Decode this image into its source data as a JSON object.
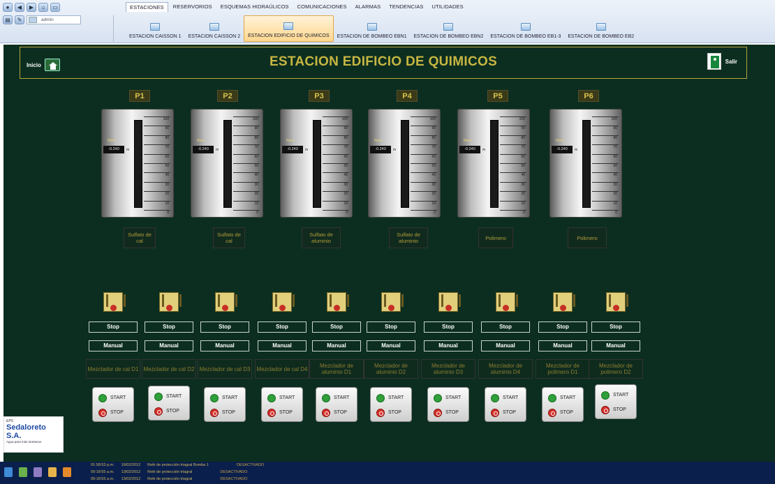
{
  "menu_tabs": [
    "ESTACIONES",
    "RESERVORIOS",
    "ESQUEMAS HIDRAÚLICOS",
    "COMUNICACIONES",
    "ALARMAS",
    "TENDENCIAS",
    "UTILIDADES"
  ],
  "user": "admin",
  "station_tabs": [
    "ESTACION CAISSON 1",
    "ESTACION CAISSON 2",
    "ESTACION EDIFICIO DE QUIMICOS",
    "ESTACION DE BOMBEO EBN1",
    "ESTACION DE BOMBEO EBN2",
    "ESTACION DE BOMBEO EB1-3",
    "ESTACION DE BOMBEO EB2"
  ],
  "active_station": "ESTACION EDIFICIO DE QUIMICOS",
  "header": {
    "home_label": "Inicio",
    "title": "ESTACION EDIFICIO DE QUIMICOS",
    "exit_label": "Salir"
  },
  "tanks": [
    {
      "label": "P1",
      "level_label": "Nivel",
      "level": "-0.240",
      "unit": "m",
      "chemical": "Sulfato de cal"
    },
    {
      "label": "P2",
      "level_label": "Nivel",
      "level": "-0.240",
      "unit": "m",
      "chemical": "Sulfato de cal"
    },
    {
      "label": "P3",
      "level_label": "Nivel",
      "level": "-0.240",
      "unit": "m",
      "chemical": "Sulfato de aluminio"
    },
    {
      "label": "P4",
      "level_label": "Nivel",
      "level": "-0.240",
      "unit": "m",
      "chemical": "Sulfato de aluminio"
    },
    {
      "label": "P5",
      "level_label": "Nivel",
      "level": "-0.240",
      "unit": "m",
      "chemical": "Polimero"
    },
    {
      "label": "P6",
      "level_label": "Nivel",
      "level": "-0.240",
      "unit": "m",
      "chemical": "Polimero"
    }
  ],
  "scale": [
    "100",
    "90",
    "80",
    "70",
    "60",
    "50",
    "40",
    "30",
    "20",
    "10",
    "0"
  ],
  "mixers": [
    {
      "state": "Stop",
      "mode": "Manual",
      "name": "Mezclador de cal D1"
    },
    {
      "state": "Stop",
      "mode": "Manual",
      "name": "Mezclador de cal D2"
    },
    {
      "state": "Stop",
      "mode": "Manual",
      "name": "Mezclador de cal D3"
    },
    {
      "state": "Stop",
      "mode": "Manual",
      "name": "Mezclador de cal D4"
    },
    {
      "state": "Stop",
      "mode": "Manual",
      "name": "Mezclador de aluminio D1"
    },
    {
      "state": "Stop",
      "mode": "Manual",
      "name": "Mezclador de aluminio D2"
    },
    {
      "state": "Stop",
      "mode": "Manual",
      "name": "Mezclador de aluminio D3"
    },
    {
      "state": "Stop",
      "mode": "Manual",
      "name": "Mezclador de aluminio D4"
    },
    {
      "state": "Stop",
      "mode": "Manual",
      "name": "Mezclador de polimero D1"
    },
    {
      "state": "Stop",
      "mode": "Manual",
      "name": "Mezclador de polimero D2"
    }
  ],
  "start_label": "START",
  "stop_label": "STOP",
  "logo": {
    "prefix": "EPS",
    "name": "Sedaloreto S.A.",
    "tagline": "Agua para más loretanos"
  },
  "alarms": [
    {
      "time": "01:58:53 p.m.",
      "date": "16/02/2012",
      "text": "Relé de protección triagral Bomba 1",
      "status": "DESACTIVADO"
    },
    {
      "time": "09:18:55 a.m.",
      "date": "13/02/2012",
      "text": "Relé de protección triagral",
      "status": "DESACTIVADO"
    },
    {
      "time": "09:18:55 a.m.",
      "date": "13/02/2012",
      "text": "Relé de protección triagral",
      "status": "DESACTIVADO"
    }
  ],
  "colors": {
    "panel_bg": "#0c2e20",
    "title": "#c7b642",
    "accent_tab": "#ffd88f",
    "bottom_bar": "#0a1f4c"
  }
}
